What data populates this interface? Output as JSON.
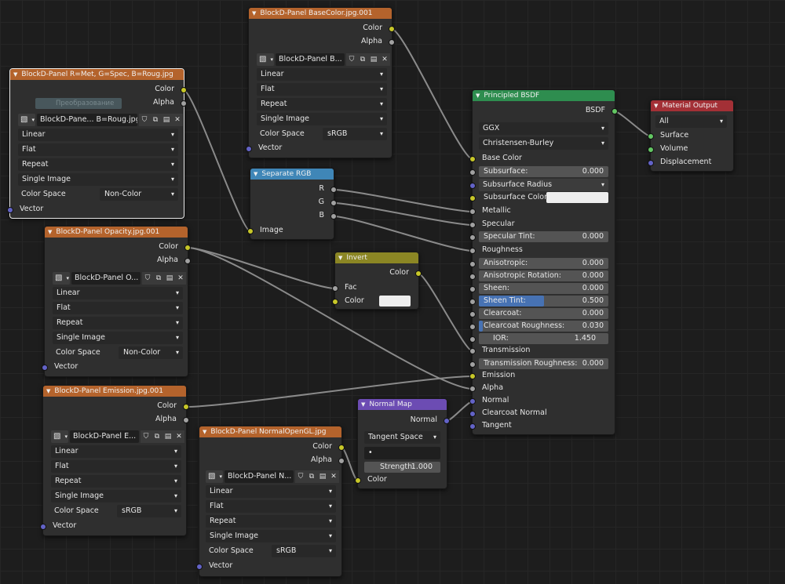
{
  "nodes": {
    "basecolor": {
      "title": "BlockD-Panel BaseColor.jpg.001",
      "outputs": [
        "Color",
        "Alpha"
      ],
      "image_name": "BlockD-Panel B...",
      "interpolation": "Linear",
      "projection": "Flat",
      "extension": "Repeat",
      "source": "Single Image",
      "color_space_label": "Color Space",
      "color_space": "sRGB",
      "input": "Vector"
    },
    "rmr": {
      "title": "BlockD-Panel R=Met, G=Spec, B=Roug.jpg",
      "outputs": [
        "Color",
        "Alpha"
      ],
      "ghost": "Преобразование",
      "image_name": "BlockD-Pane... B=Roug.jpg",
      "interpolation": "Linear",
      "projection": "Flat",
      "extension": "Repeat",
      "source": "Single Image",
      "color_space_label": "Color Space",
      "color_space": "Non-Color",
      "input": "Vector"
    },
    "opacity": {
      "title": "BlockD-Panel Opacity.jpg.001",
      "outputs": [
        "Color",
        "Alpha"
      ],
      "image_name": "BlockD-Panel O...",
      "interpolation": "Linear",
      "projection": "Flat",
      "extension": "Repeat",
      "source": "Single Image",
      "color_space_label": "Color Space",
      "color_space": "Non-Color",
      "input": "Vector"
    },
    "emission": {
      "title": "BlockD-Panel Emission.jpg.001",
      "outputs": [
        "Color",
        "Alpha"
      ],
      "image_name": "BlockD-Panel E...",
      "interpolation": "Linear",
      "projection": "Flat",
      "extension": "Repeat",
      "source": "Single Image",
      "color_space_label": "Color Space",
      "color_space": "sRGB",
      "input": "Vector"
    },
    "normalgl": {
      "title": "BlockD-Panel NormalOpenGL.jpg",
      "outputs": [
        "Color",
        "Alpha"
      ],
      "image_name": "BlockD-Panel N...",
      "interpolation": "Linear",
      "projection": "Flat",
      "extension": "Repeat",
      "source": "Single Image",
      "color_space_label": "Color Space",
      "color_space": "sRGB",
      "input": "Vector"
    },
    "separate": {
      "title": "Separate RGB",
      "outputs": [
        "R",
        "G",
        "B"
      ],
      "input": "Image"
    },
    "invert": {
      "title": "Invert",
      "output": "Color",
      "fac": "Fac",
      "color": "Color"
    },
    "normalmap": {
      "title": "Normal Map",
      "output": "Normal",
      "space": "Tangent Space",
      "uvmap": "•",
      "strength_label": "Strength:",
      "strength_value": "1.000",
      "color": "Color"
    },
    "bsdf": {
      "title": "Principled BSDF",
      "output": "BSDF",
      "distribution": "GGX",
      "subsurface_method": "Christensen-Burley",
      "base_color": "Base Color",
      "subsurface": {
        "label": "Subsurface:",
        "value": "0.000"
      },
      "subsurface_radius": "Subsurface Radius",
      "subsurface_color": "Subsurface Color",
      "metallic": "Metallic",
      "specular": "Specular",
      "specular_tint": {
        "label": "Specular Tint:",
        "value": "0.000"
      },
      "roughness": "Roughness",
      "anisotropic": {
        "label": "Anisotropic:",
        "value": "0.000"
      },
      "anisotropic_rotation": {
        "label": "Anisotropic Rotation:",
        "value": "0.000"
      },
      "sheen": {
        "label": "Sheen:",
        "value": "0.000"
      },
      "sheen_tint": {
        "label": "Sheen Tint:",
        "value": "0.500",
        "fraction": 0.5
      },
      "clearcoat": {
        "label": "Clearcoat:",
        "value": "0.000"
      },
      "clearcoat_roughness": {
        "label": "Clearcoat Roughness:",
        "value": "0.030",
        "fraction": 0.03
      },
      "ior": {
        "label": "IOR:",
        "value": "1.450"
      },
      "transmission": "Transmission",
      "transmission_roughness": {
        "label": "Transmission Roughness:",
        "value": "0.000"
      },
      "emission": "Emission",
      "alpha": "Alpha",
      "normal": "Normal",
      "clearcoat_normal": "Clearcoat Normal",
      "tangent": "Tangent"
    },
    "output": {
      "title": "Material Output",
      "target": "All",
      "surface": "Surface",
      "volume": "Volume",
      "displacement": "Displacement"
    }
  },
  "colors": {
    "texture_header": "#b4632c",
    "shader_header": "#2e8d4f",
    "converter_header": "#3f86b7",
    "color_header": "#8b8624",
    "vector_header": "#6c4cb3",
    "output_header": "#a33036",
    "wire": "#8a8a8a",
    "socket_color": "#c7c729",
    "socket_float": "#a1a1a1",
    "socket_vector": "#6363c7",
    "socket_shader": "#63c763",
    "field_fill": "#4772b3"
  }
}
